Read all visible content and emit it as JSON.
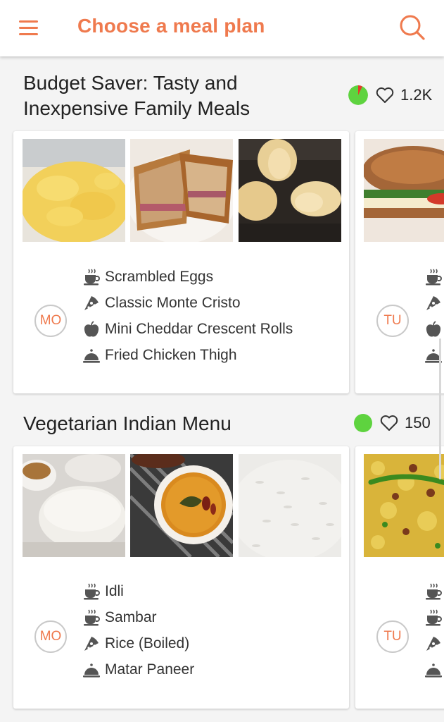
{
  "appbar": {
    "title": "Choose a meal plan",
    "accent": "#ef7a4e"
  },
  "plans": [
    {
      "title_line1": "Budget Saver: Tasty and",
      "title_line2": "Inexpensive Family Meals",
      "status": "partial-pie",
      "likes": "1.2K",
      "days": [
        {
          "day": "MO",
          "meals": [
            {
              "icon": "coffee-cup-icon",
              "name": "Scrambled Eggs"
            },
            {
              "icon": "pizza-slice-icon",
              "name": "Classic Monte Cristo"
            },
            {
              "icon": "apple-icon",
              "name": "Mini Cheddar Crescent Rolls"
            },
            {
              "icon": "cloche-icon",
              "name": "Fried Chicken Thigh"
            }
          ]
        },
        {
          "day": "TU"
        }
      ]
    },
    {
      "title_line1": "Vegetarian Indian Menu",
      "status": "green",
      "likes": "150",
      "days": [
        {
          "day": "MO",
          "meals": [
            {
              "icon": "coffee-cup-icon",
              "name": "Idli"
            },
            {
              "icon": "coffee-cup-icon",
              "name": "Sambar"
            },
            {
              "icon": "pizza-slice-icon",
              "name": "Rice (Boiled)"
            },
            {
              "icon": "cloche-icon",
              "name": "Matar Paneer"
            }
          ]
        },
        {
          "day": "TU"
        }
      ]
    }
  ]
}
